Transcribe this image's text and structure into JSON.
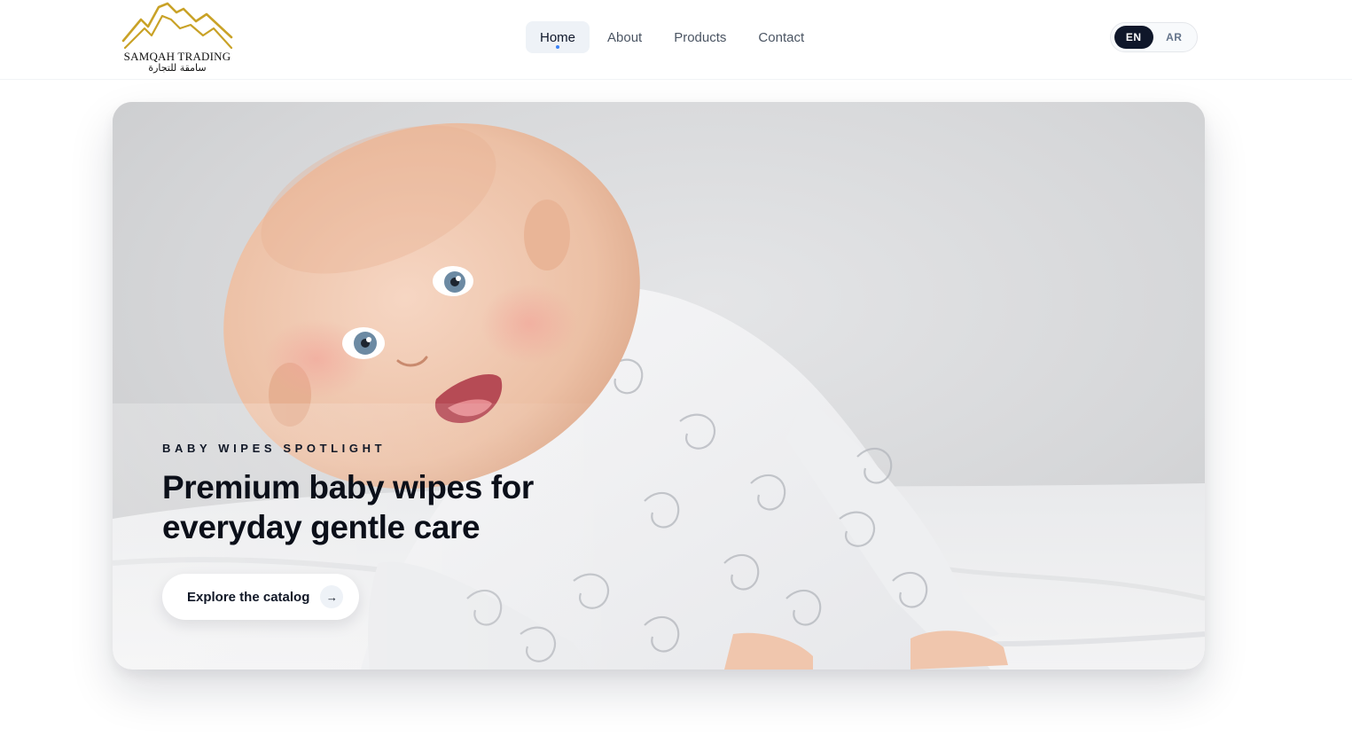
{
  "brand": {
    "name_en": "SAMQAH TRADING",
    "name_ar": "سامقة للتجارة",
    "mark_color": "#c9a227"
  },
  "nav": {
    "items": [
      {
        "label": "Home",
        "active": true
      },
      {
        "label": "About",
        "active": false
      },
      {
        "label": "Products",
        "active": false
      },
      {
        "label": "Contact",
        "active": false
      }
    ]
  },
  "language": {
    "options": [
      "EN",
      "AR"
    ],
    "selected": "EN"
  },
  "hero": {
    "eyebrow": "BABY WIPES SPOTLIGHT",
    "title": "Premium baby wipes for everyday gentle care",
    "cta_label": "Explore the catalog",
    "cta_icon": "arrow-right-icon",
    "image_subject": "smiling baby in white patterned sleepsuit lying on a bed"
  },
  "colors": {
    "accent": "#0f172a",
    "nav_active_bg": "#eef2f7",
    "active_dot": "#3b82f6"
  }
}
